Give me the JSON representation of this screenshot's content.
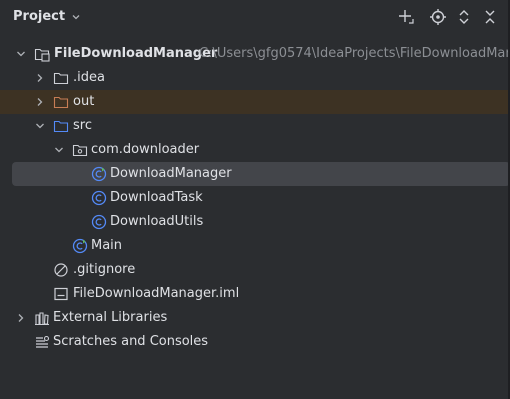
{
  "header": {
    "title": "Project",
    "buttons": [
      "add-icon",
      "locate-icon",
      "expand-collapse-icon",
      "collapse-all-icon"
    ]
  },
  "tree": {
    "root": {
      "label": "FileDownloadManager",
      "path": "C:\\Users\\gfg0574\\IdeaProjects\\FileDownloadMana"
    },
    "idea": ".idea",
    "out": "out",
    "src": "src",
    "package": "com.downloader",
    "download_manager": "DownloadManager",
    "download_task": "DownloadTask",
    "download_utils": "DownloadUtils",
    "main": "Main",
    "gitignore": ".gitignore",
    "iml": "FileDownloadManager.iml",
    "external_libraries": "External Libraries",
    "scratches": "Scratches and Consoles"
  },
  "colors": {
    "background": "#2b2d30",
    "selected_row": "#43454a",
    "excluded_row": "#3d3223",
    "text": "#dfe1e5",
    "path_text": "#8c8f94",
    "class_icon": "#548af7",
    "main_badge": "#5fb865",
    "excluded_folder": "#c77d55"
  }
}
